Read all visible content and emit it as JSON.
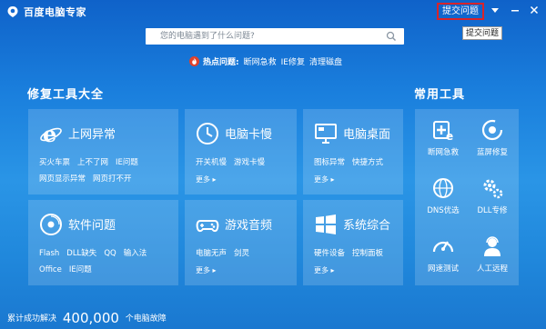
{
  "window": {
    "title": "百度电脑专家"
  },
  "titlebar": {
    "submit_label": "提交问题",
    "tooltip": "提交问题"
  },
  "search": {
    "placeholder": "您的电脑遇到了什么问题?"
  },
  "hot": {
    "label": "热点问题:",
    "items": [
      "断网急救",
      "IE修复",
      "清理磁盘"
    ]
  },
  "repair": {
    "heading": "修复工具大全",
    "cards": [
      {
        "title": "上网异常",
        "links_row1": [
          "买火车票",
          "上不了网",
          "IE问题"
        ],
        "links_row2": [
          "网页显示异常",
          "网页打不开"
        ]
      },
      {
        "title": "电脑卡慢",
        "links_row1": [
          "开关机慢",
          "游戏卡慢"
        ],
        "more": "更多 ▸"
      },
      {
        "title": "电脑桌面",
        "links_row1": [
          "图标异常",
          "快捷方式"
        ],
        "more": "更多 ▸"
      },
      {
        "title": "软件问题",
        "links_row1": [
          "Flash",
          "DLL缺失",
          "QQ",
          "输入法"
        ],
        "links_row2": [
          "Office",
          "IE问题"
        ]
      },
      {
        "title": "游戏音频",
        "links_row1": [
          "电脑无声",
          "剑灵"
        ],
        "more": "更多 ▸"
      },
      {
        "title": "系统综合",
        "links_row1": [
          "硬件设备",
          "控制面板"
        ],
        "more": "更多 ▸"
      }
    ]
  },
  "tools": {
    "heading": "常用工具",
    "items": [
      {
        "label": "断网急救",
        "icon": "network-rescue-icon"
      },
      {
        "label": "蓝屏修复",
        "icon": "bluescreen-repair-icon"
      },
      {
        "label": "DNS优选",
        "icon": "dns-icon"
      },
      {
        "label": "DLL专修",
        "icon": "dll-gear-icon"
      },
      {
        "label": "网速测试",
        "icon": "speedometer-icon"
      },
      {
        "label": "人工远程",
        "icon": "remote-person-icon"
      }
    ]
  },
  "footer": {
    "prefix": "累计成功解决",
    "count": "400,000",
    "suffix": "个电脑故障"
  },
  "colors": {
    "accent_red": "#d8242a",
    "bg_top": "#0f62c9",
    "bg_mid": "#2a95e6"
  }
}
